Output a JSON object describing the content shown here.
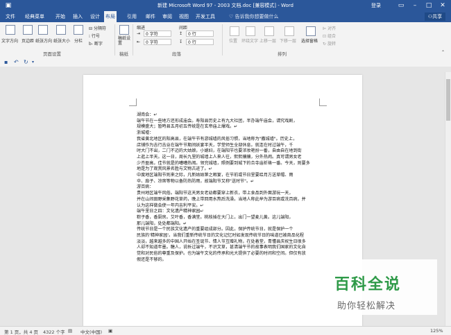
{
  "titlebar": {
    "title": "新建 Microsoft Word 97 - 2003 文档.doc [兼容模式] - Word",
    "login": "登录"
  },
  "tabs": [
    "文件",
    "经典菜单",
    "开始",
    "插入",
    "设计",
    "布局",
    "引用",
    "邮件",
    "审阅",
    "视图",
    "开发工具"
  ],
  "tell_me": "告诉我你想要做什么",
  "share": "共享",
  "ribbon": {
    "text_direction": "文字方向",
    "margins": "页边距",
    "orientation": "纸张方向",
    "size": "纸张大小",
    "columns": "分栏",
    "breaks": "分隔符",
    "line_numbers": "行号",
    "hyphenation": "断字",
    "group_page_setup": "页面设置",
    "draft": "稿纸设置",
    "group_draft": "稿纸",
    "indent": "缩进",
    "spacing": "间距",
    "indent_left": "0 字符",
    "indent_right": "0 字符",
    "spacing_before": "0 行",
    "spacing_after": "0 行",
    "group_paragraph": "段落",
    "position": "位置",
    "wrap_text": "环绕文字",
    "bring_forward": "上移一层",
    "send_backward": "下移一层",
    "selection_pane": "选择窗格",
    "align": "对齐",
    "group": "组合",
    "rotate": "旋转",
    "group_arrange": "排列"
  },
  "document": {
    "lines": [
      "湖南会：↵",
      "端午节在一些地方还形成庙会。寿阳县历史上有九大社团，半办端午庙会，请究戏剧，",
      "规模盛大；暂時县五月初五传统是在玄帝庙上爆戏。↵",
      "浙城墟：",
      "我省黄北地区的阳高县，在端午节有游城墟的风俗习惯，当地称为\"撒城墟\"。历史上，",
      "店铺作为吉行吉业在端午节期间妖宴半天，学堂师生全部休息。就连在时过端午，千",
      "时大门不出，二门不迈的大姑娘，小媳妇，在端阳节也要浓妆艳扮一番，自由自在地到街",
      "上逛上半天。这一日，周长九里的城墙上人来人往，熙熙攘攘，分外热闹。真可谓男女老",
      "少齐盈高，佳节就是的嘈嘈热闹。领完城墙，照例要到城下的合寺庙祈祷一番。今天，则要多",
      "地是为了观赏风景名胜与文物古迹了。↵",
      "中度地区端阳节则来之际，凡新姑姑第之暇宴，在节前或节日里要给月方送草帽、雨",
      "伞、扇子、凉席等物以备防热防雨，故端阳节又称\"送时节\"。↵",
      "游百病：",
      "贵州地区端午风俗。端阳节这天男女老幼都要穿上新衣，带上食品到外面游玩一天，",
      "并在山间田野采集野花草药，晚上带回用水熬后洗澡。当地人称此举为游百病或洗百病，并",
      "认为这样做会使一年内吉利平安。↵",
      "端午里日之四：文化遗产精神家园↵",
      "粽子香，香厨房。艾叶香，香满堂。桃枝插在大门上，出门一望麦儿黄。这儿端阳，",
      "那儿端阳，处处都端阳。↵",
      "传统节日是一个民族文化遗产的重要组成部分。因此，保护传统节日，就是保护一个",
      "民族的'精神家园'。当我们重新传统节日的文化记忆时如发现传统节日的味道已被商品化程",
      "淡淡，越来越多的中国人开始在圣诞节、情人节互赠礼物，在处着堂，青懂县庆祝生日很多",
      "人却不知道年墨。糖人，说析过端午，不识文草，甚清端午节的故事表明我们国家的文化自",
      "觉和对民俗的尊重及保护。也为端午文化的传承和光大提供了必要的时间和空间。但仅有放",
      "假还是不够的。"
    ]
  },
  "statusbar": {
    "page": "第 1 页，共 4 页",
    "words": "4322 个字",
    "language": "中文(中国)",
    "zoom": "125%"
  },
  "watermark": {
    "big": "百科全说",
    "small": "助你轻松解决"
  }
}
